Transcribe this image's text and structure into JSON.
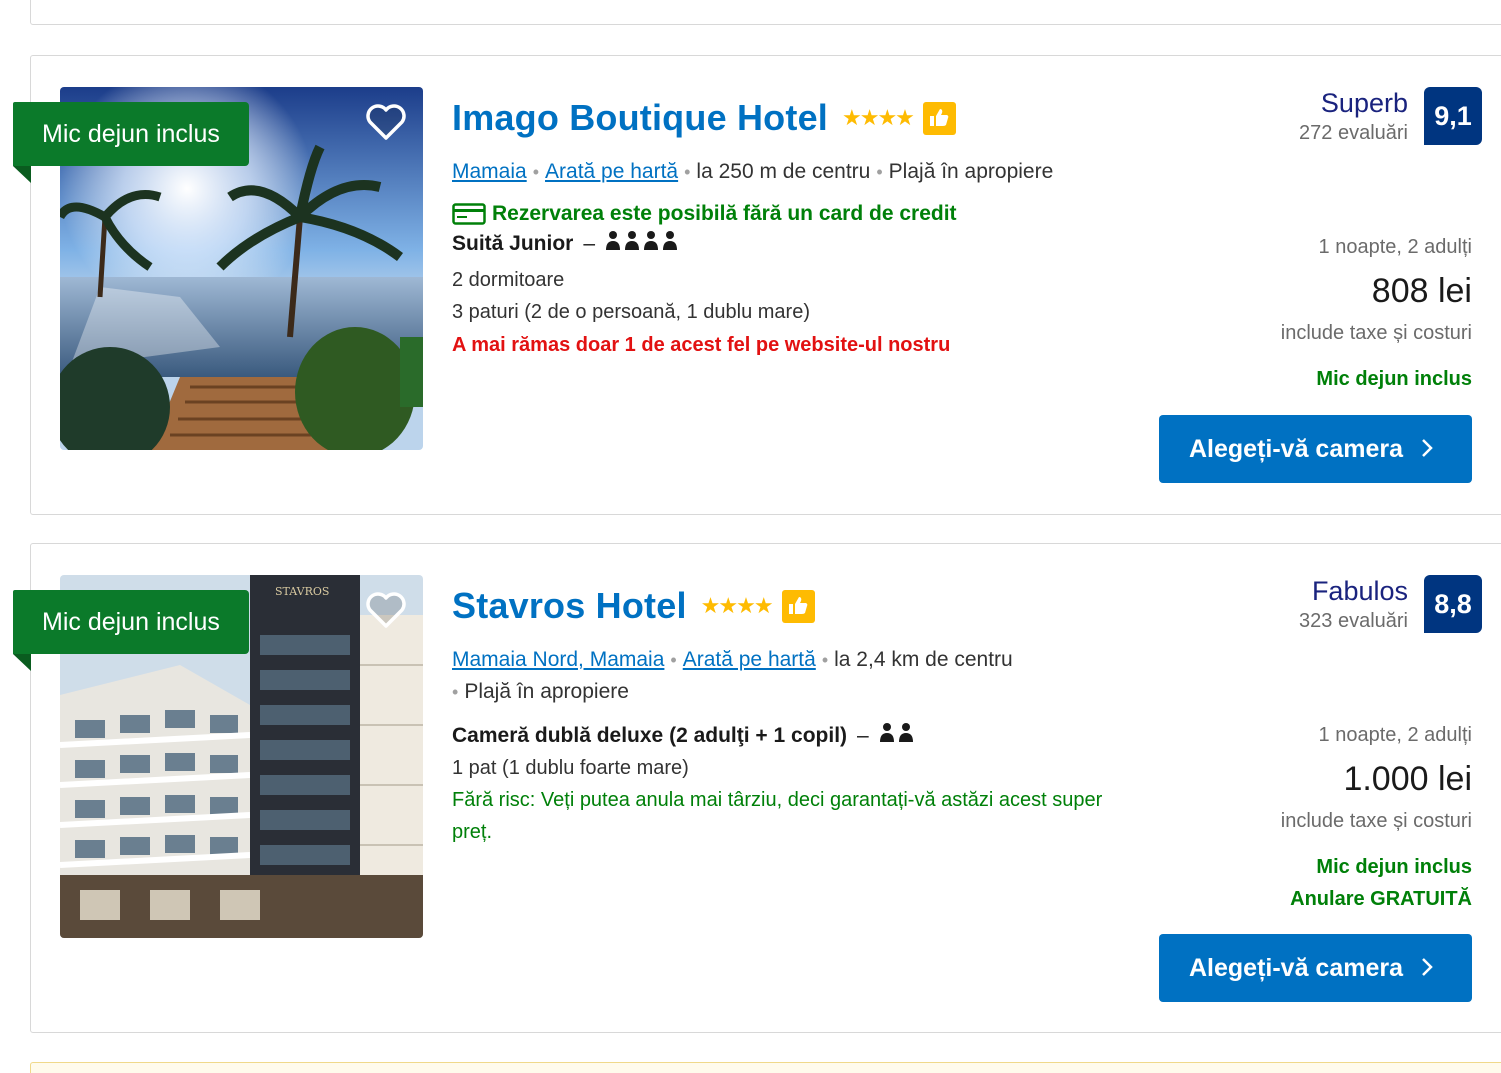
{
  "listings": [
    {
      "badge": "Mic dejun inclus",
      "name": "Imago Boutique Hotel",
      "stars": "★★★★",
      "location": "Mamaia",
      "map_link": "Arată pe hartă",
      "distance": "la 250 m de centru",
      "beach": "Plajă în apropiere",
      "no_card": "Rezervarea este posibilă fără un card de credit",
      "room_type": "Suită Junior",
      "room_lines": [
        "2 dormitoare",
        "3 paturi (2 de o persoană, 1 dublu mare)"
      ],
      "warning": "A mai rămas doar 1 de acest fel pe website-ul nostru",
      "score_word": "Superb",
      "reviews": "272 evaluări",
      "score": "9,1",
      "nights": "1 noapte, 2 adulți",
      "price": "808 lei",
      "taxes": "include taxe și costuri",
      "perks": [
        "Mic dejun inclus"
      ],
      "cta": "Alegeți-vă camera"
    },
    {
      "badge": "Mic dejun inclus",
      "name": "Stavros Hotel",
      "stars": "★★★★",
      "location": "Mamaia Nord, Mamaia",
      "map_link": "Arată pe hartă",
      "distance": "la 2,4 km de centru",
      "beach": "Plajă în apropiere",
      "room_type": "Cameră dublă deluxe (2 adulţi + 1 copil)",
      "room_lines": [
        "1 pat (1 dublu foarte mare)"
      ],
      "free_cancel_note": "Fără risc: Veți putea anula mai târziu, deci garantați-vă astăzi acest super preț.",
      "score_word": "Fabulos",
      "reviews": "323 evaluări",
      "score": "8,8",
      "nights": "1 noapte, 2 adulți",
      "price": "1.000 lei",
      "taxes": "include taxe și costuri",
      "perks": [
        "Mic dejun inclus",
        "Anulare GRATUITĂ"
      ],
      "cta": "Alegeți-vă camera"
    }
  ],
  "colors": {
    "link_blue": "#0071c2",
    "score_navy": "#003580",
    "badge_green": "#0b7a2a",
    "perk_green": "#008009",
    "warning_red": "#e21111",
    "star_yellow": "#febb02"
  },
  "icons": [
    "heart-icon",
    "thumbs-up-icon",
    "credit-card-icon",
    "person-icon",
    "chevron-right-icon"
  ]
}
